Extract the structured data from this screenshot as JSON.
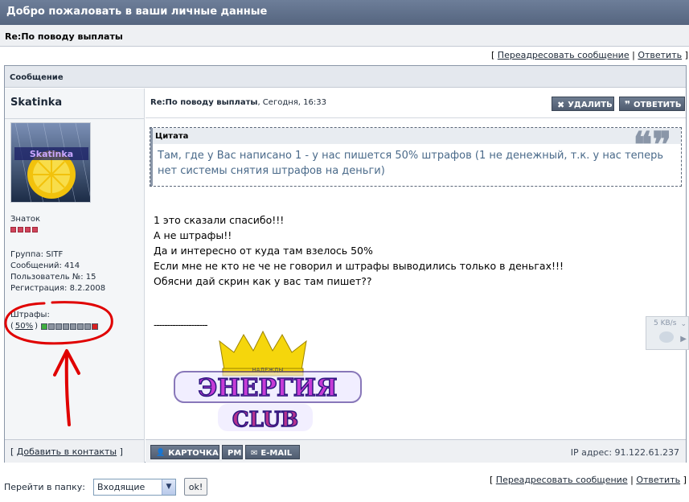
{
  "window": {
    "title": "Добро пожаловать в ваши личные данные"
  },
  "topic": {
    "title": "Re:По поводу выплаты"
  },
  "top_links": {
    "open": "[",
    "forward": "Переадресовать сообщение",
    "sep": "|",
    "reply": "Ответить",
    "close": "]"
  },
  "panel": {
    "header": "Сообщение"
  },
  "author": {
    "name": "Skatinka",
    "avatar_text": "Skatinka",
    "rank": "Знаток",
    "rank_pips": 4,
    "stats": [
      "Группа: SITF",
      "Сообщений: 414",
      "Пользователь №: 15",
      "Регистрация: 8.2.2008"
    ],
    "warnings_label": "Штрафы:",
    "warnings_open": "(",
    "warnings_percent": "50%",
    "warnings_close": ")",
    "warnings_level": 0.5,
    "warning_colors": [
      "#3fae3f",
      "#8c94a0",
      "#8c94a0",
      "#8c94a0",
      "#8c94a0",
      "#8c94a0",
      "#8c94a0",
      "#d82020"
    ]
  },
  "post": {
    "title": "Re:По поводу выплаты",
    "time": ", Сегодня, 16:33",
    "buttons": {
      "delete": "УДАЛИТЬ",
      "reply": "ОТВЕТИТЬ"
    },
    "quote": {
      "label": "Цитата",
      "text": "Там, где у Вас написано 1 - у нас пишется 50% штрафов (1 не денежный, т.к. у нас теперь нет системы снятия штрафов на деньги)"
    },
    "body_lines": [
      "1 это сказали спасибо!!!",
      "А не штрафы!!",
      "Да и интересно от куда там взелось 50%",
      "Если мне не кто не че не говорил и штрафы выводились только в деньгах!!!",
      "Обясни дай скрин как у вас там пишет??"
    ],
    "signature_line": "--------------------",
    "signature": {
      "line1": "ЭНЕРГИЯ",
      "line2": "CLUB",
      "small": "НАДЕЖДЫ"
    }
  },
  "bottom": {
    "add_contact_open": "[",
    "add_contact": "Добавить в контакты",
    "add_contact_close": "]",
    "card": "КАРТОЧКА",
    "pm": "PM",
    "email": "E-MAIL",
    "ip": "IP адрес: 91.122.61.237"
  },
  "ad": {
    "speed": "5 KB/s"
  },
  "footer": {
    "goto_label": "Перейти в папку:",
    "folder": "Входящие",
    "ok": "ok!",
    "open": "[",
    "forward": "Переадресовать сообщение",
    "sep": "|",
    "reply": "Ответить",
    "close": "]"
  },
  "colors": {
    "header_bg": "#5f6f89",
    "annotation_red": "#e00000",
    "quote_text": "#4a6a8a"
  }
}
